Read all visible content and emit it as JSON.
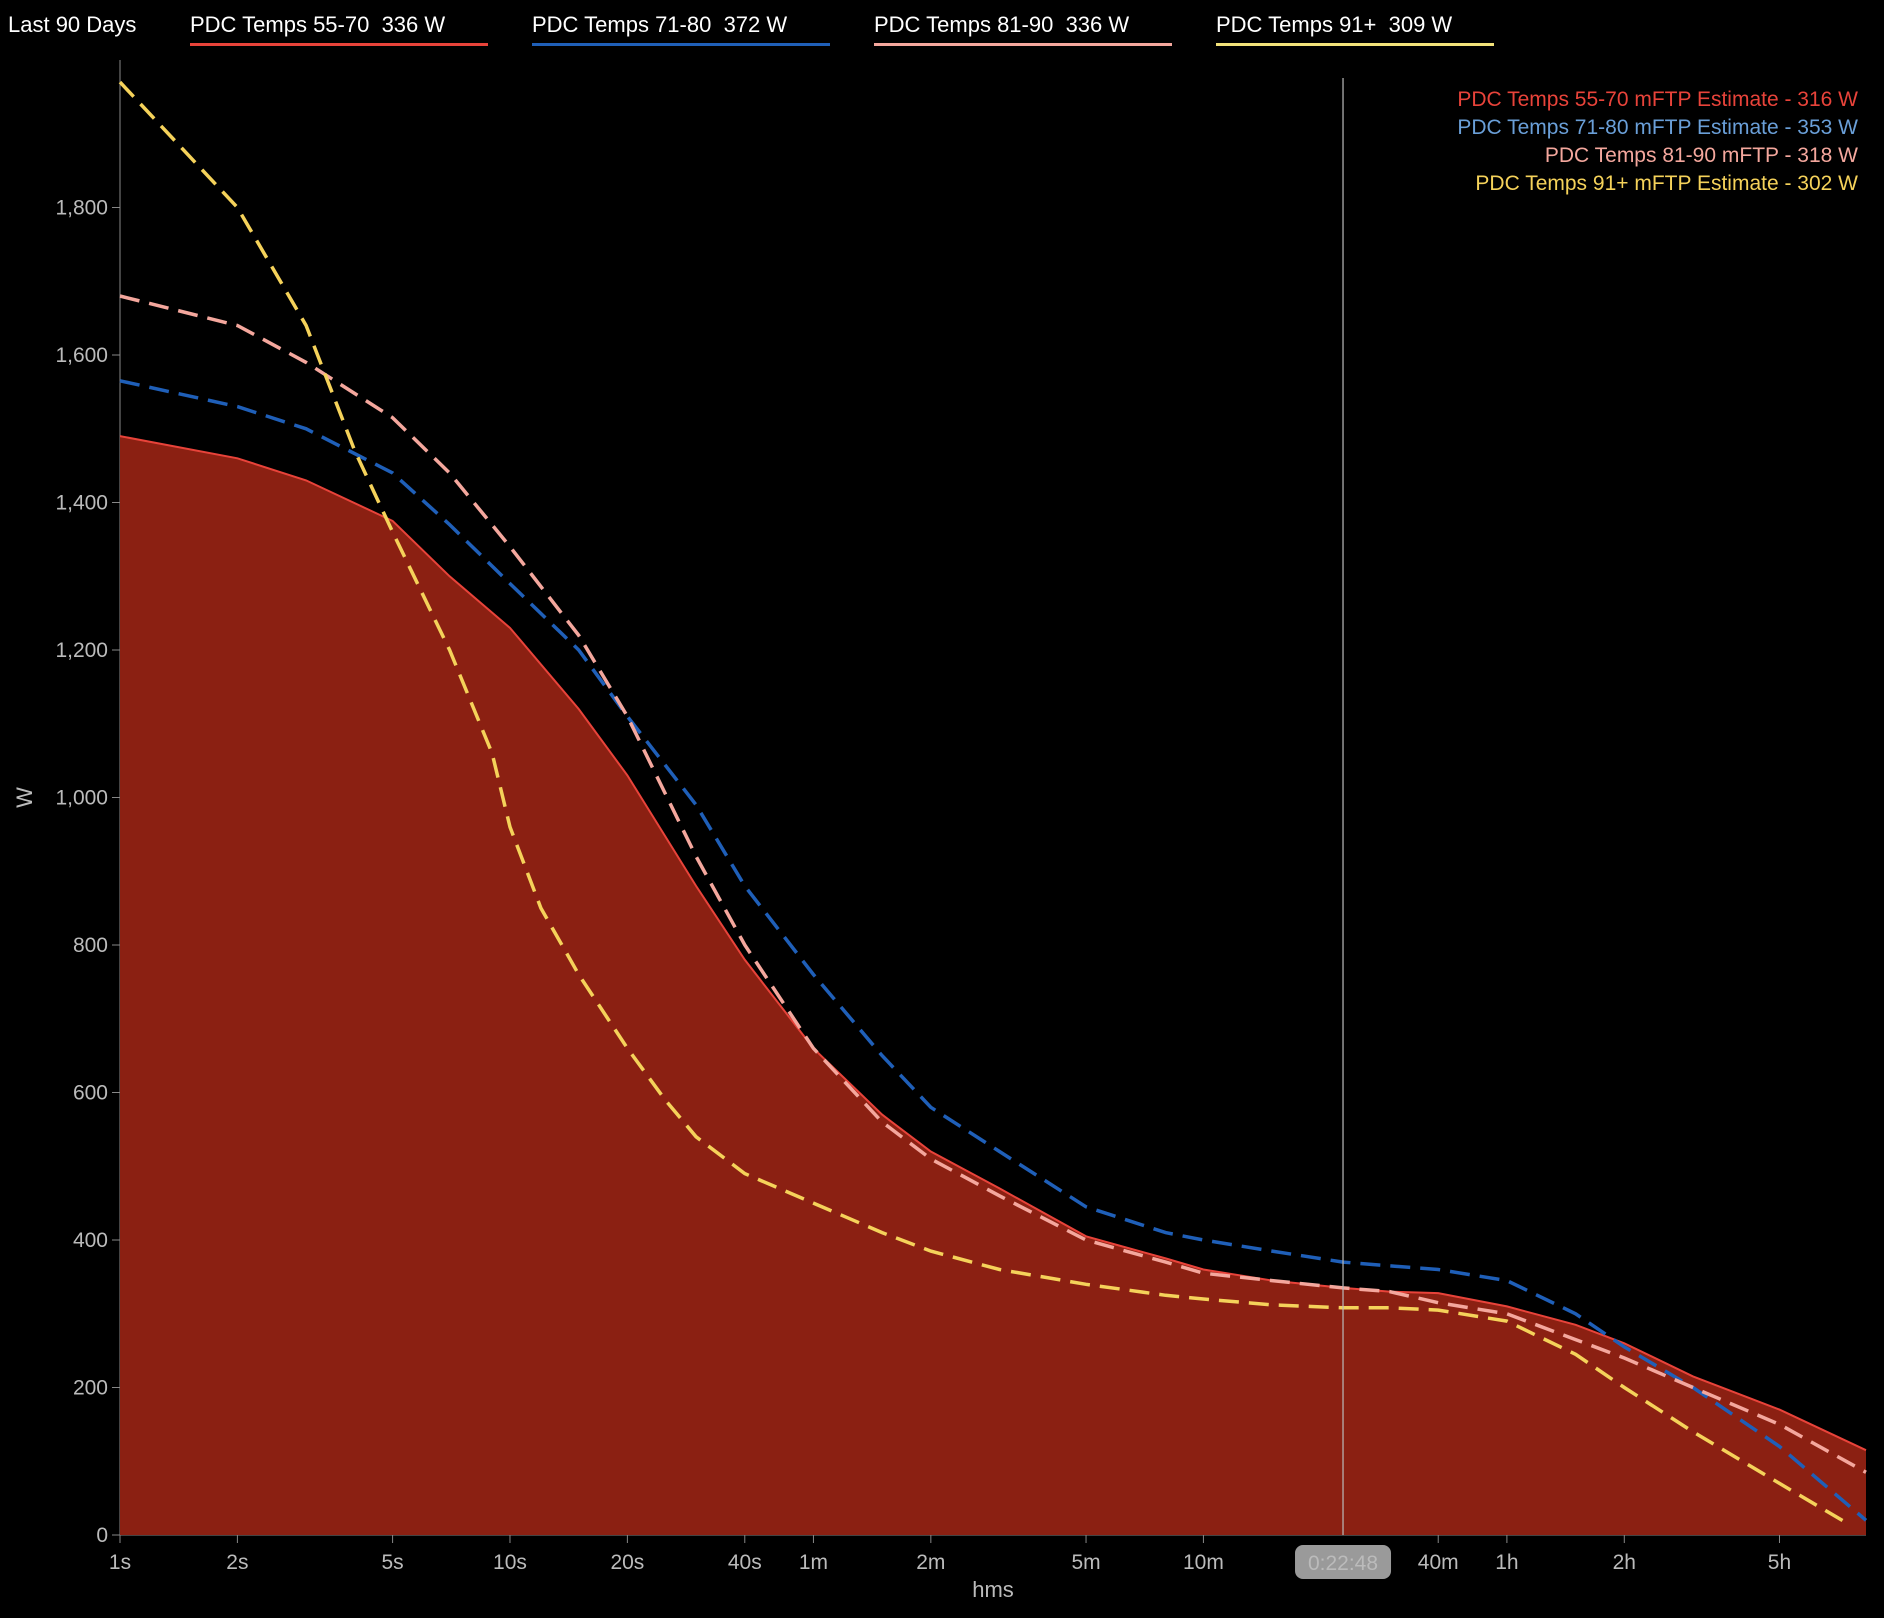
{
  "header": {
    "range_label": "Last 90 Days",
    "legend": [
      {
        "label": "PDC Temps 55-70  336 W",
        "color": "#e8433a"
      },
      {
        "label": "PDC Temps 71-80  372 W",
        "color": "#1f5fb8"
      },
      {
        "label": "PDC Temps 81-90  336 W",
        "color": "#f4a79d"
      },
      {
        "label": "PDC Temps 91+  309 W",
        "color": "#f2e27a"
      }
    ]
  },
  "colors": {
    "background": "#000000",
    "area_fill": "#8b2012",
    "series_55_70": "#e8433a",
    "series_71_80": "#1f5fb8",
    "series_81_90": "#f4a79d",
    "series_91": "#f5d25a",
    "estimate_71_80": "#6a9fd8"
  },
  "estimates": [
    {
      "label": "PDC Temps 55-70 mFTP Estimate - 316 W",
      "color": "#e8433a"
    },
    {
      "label": "PDC Temps 71-80 mFTP Estimate - 353 W",
      "color": "#6a9fd8"
    },
    {
      "label": "PDC Temps 81-90 mFTP - 318 W",
      "color": "#f4a79d"
    },
    {
      "label": "PDC Temps 91+ mFTP Estimate - 302 W",
      "color": "#f5d25a"
    }
  ],
  "cursor": {
    "label": "0:22:48",
    "seconds": 1368
  },
  "chart_data": {
    "type": "line",
    "xscale": "log",
    "xlabel": "hms",
    "ylabel": "W",
    "ylim": [
      0,
      2000
    ],
    "xlim": [
      1,
      30000
    ],
    "x_ticks": [
      {
        "label": "1s",
        "value": 1
      },
      {
        "label": "2s",
        "value": 2
      },
      {
        "label": "5s",
        "value": 5
      },
      {
        "label": "10s",
        "value": 10
      },
      {
        "label": "20s",
        "value": 20
      },
      {
        "label": "40s",
        "value": 40
      },
      {
        "label": "1m",
        "value": 60
      },
      {
        "label": "2m",
        "value": 120
      },
      {
        "label": "5m",
        "value": 300
      },
      {
        "label": "10m",
        "value": 600
      },
      {
        "label": "40m",
        "value": 2400
      },
      {
        "label": "1h",
        "value": 3600
      },
      {
        "label": "2h",
        "value": 7200
      },
      {
        "label": "5h",
        "value": 18000
      }
    ],
    "y_ticks": [
      {
        "label": "0",
        "value": 0
      },
      {
        "label": "200",
        "value": 200
      },
      {
        "label": "400",
        "value": 400
      },
      {
        "label": "600",
        "value": 600
      },
      {
        "label": "800",
        "value": 800
      },
      {
        "label": "1,000",
        "value": 1000
      },
      {
        "label": "1,200",
        "value": 1200
      },
      {
        "label": "1,400",
        "value": 1400
      },
      {
        "label": "1,600",
        "value": 1600
      },
      {
        "label": "1,800",
        "value": 1800
      }
    ],
    "series": [
      {
        "name": "PDC Temps 55-70",
        "style": "area",
        "points": [
          [
            1,
            1490
          ],
          [
            2,
            1460
          ],
          [
            3,
            1430
          ],
          [
            5,
            1375
          ],
          [
            7,
            1300
          ],
          [
            10,
            1230
          ],
          [
            15,
            1120
          ],
          [
            20,
            1030
          ],
          [
            30,
            880
          ],
          [
            40,
            780
          ],
          [
            60,
            660
          ],
          [
            90,
            570
          ],
          [
            120,
            520
          ],
          [
            180,
            470
          ],
          [
            300,
            405
          ],
          [
            480,
            375
          ],
          [
            600,
            360
          ],
          [
            900,
            345
          ],
          [
            1368,
            335
          ],
          [
            1800,
            330
          ],
          [
            2400,
            328
          ],
          [
            3600,
            310
          ],
          [
            5400,
            285
          ],
          [
            7200,
            260
          ],
          [
            10800,
            215
          ],
          [
            18000,
            170
          ],
          [
            30000,
            115
          ]
        ]
      },
      {
        "name": "PDC Temps 71-80",
        "style": "dashed",
        "points": [
          [
            1,
            1565
          ],
          [
            2,
            1530
          ],
          [
            3,
            1500
          ],
          [
            5,
            1440
          ],
          [
            7,
            1370
          ],
          [
            10,
            1290
          ],
          [
            15,
            1200
          ],
          [
            20,
            1110
          ],
          [
            30,
            990
          ],
          [
            40,
            880
          ],
          [
            60,
            760
          ],
          [
            90,
            650
          ],
          [
            120,
            580
          ],
          [
            180,
            520
          ],
          [
            300,
            445
          ],
          [
            480,
            410
          ],
          [
            600,
            400
          ],
          [
            900,
            385
          ],
          [
            1368,
            370
          ],
          [
            1800,
            365
          ],
          [
            2400,
            360
          ],
          [
            3600,
            345
          ],
          [
            5400,
            300
          ],
          [
            7200,
            255
          ],
          [
            10800,
            200
          ],
          [
            18000,
            120
          ],
          [
            30000,
            20
          ]
        ]
      },
      {
        "name": "PDC Temps 81-90",
        "style": "dashed",
        "points": [
          [
            1,
            1680
          ],
          [
            2,
            1640
          ],
          [
            3,
            1590
          ],
          [
            5,
            1515
          ],
          [
            7,
            1440
          ],
          [
            10,
            1340
          ],
          [
            15,
            1220
          ],
          [
            20,
            1110
          ],
          [
            30,
            920
          ],
          [
            40,
            800
          ],
          [
            60,
            660
          ],
          [
            90,
            560
          ],
          [
            120,
            510
          ],
          [
            180,
            460
          ],
          [
            300,
            400
          ],
          [
            480,
            370
          ],
          [
            600,
            355
          ],
          [
            900,
            345
          ],
          [
            1368,
            335
          ],
          [
            1800,
            330
          ],
          [
            2400,
            315
          ],
          [
            3600,
            300
          ],
          [
            5400,
            265
          ],
          [
            7200,
            240
          ],
          [
            10800,
            200
          ],
          [
            18000,
            150
          ],
          [
            30000,
            85
          ]
        ]
      },
      {
        "name": "PDC Temps 91+",
        "style": "dashed",
        "points": [
          [
            1,
            1970
          ],
          [
            2,
            1800
          ],
          [
            3,
            1640
          ],
          [
            4,
            1470
          ],
          [
            5,
            1360
          ],
          [
            7,
            1200
          ],
          [
            9,
            1060
          ],
          [
            10,
            960
          ],
          [
            12,
            850
          ],
          [
            15,
            760
          ],
          [
            20,
            660
          ],
          [
            25,
            590
          ],
          [
            30,
            540
          ],
          [
            40,
            490
          ],
          [
            60,
            450
          ],
          [
            90,
            410
          ],
          [
            120,
            385
          ],
          [
            180,
            360
          ],
          [
            300,
            340
          ],
          [
            480,
            325
          ],
          [
            600,
            320
          ],
          [
            900,
            312
          ],
          [
            1368,
            308
          ],
          [
            1800,
            308
          ],
          [
            2400,
            305
          ],
          [
            3600,
            290
          ],
          [
            5400,
            245
          ],
          [
            7200,
            200
          ],
          [
            10800,
            140
          ],
          [
            18000,
            70
          ],
          [
            27000,
            15
          ]
        ]
      }
    ]
  }
}
